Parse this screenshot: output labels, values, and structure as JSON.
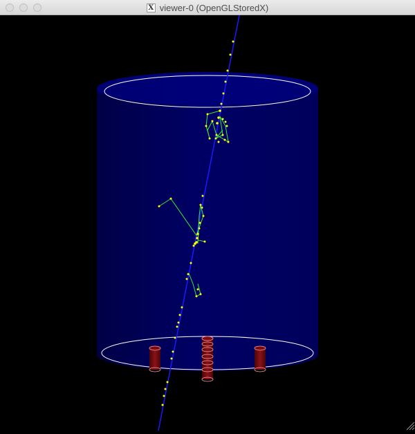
{
  "window": {
    "title": "viewer-0 (OpenGLStoredX)",
    "title_icon_glyph": "X",
    "title_icon": "x11-icon"
  },
  "viewer": {
    "background": "#000000",
    "detector_fill": "#00005a",
    "ring_color": "#ffffff",
    "beam_color": "#0000ff",
    "track_color": "#33ff33",
    "hit_color": "#ffff00",
    "tube_color": "#7a0b12"
  },
  "controls": {
    "close": "close-button",
    "minimize": "minimize-button",
    "zoom": "zoom-button",
    "resize": "resize-grip-icon"
  }
}
